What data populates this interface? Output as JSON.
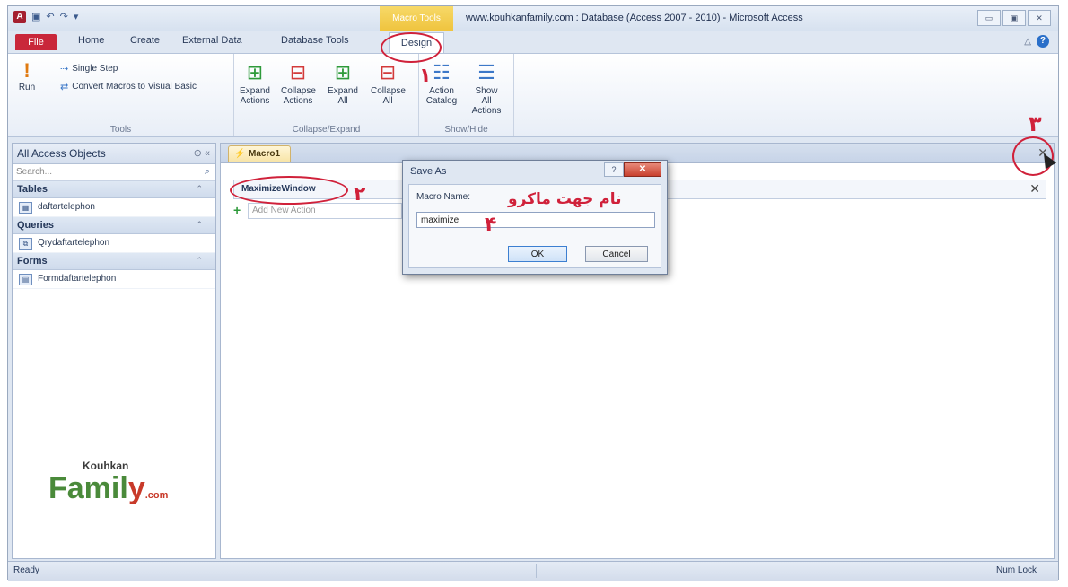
{
  "app": {
    "title": "www.kouhkanfamily.com : Database (Access 2007 - 2010)  -  Microsoft Access",
    "context_tab_header": "Macro Tools",
    "icons": [
      "access-logo-icon",
      "save-icon",
      "undo-icon",
      "redo-icon",
      "qat-dropdown-icon"
    ]
  },
  "window_controls": {
    "minimize": "▭",
    "maximize": "▣",
    "close": "✕"
  },
  "ribbon_tabs": [
    "File",
    "Home",
    "Create",
    "External Data",
    "Database Tools",
    "Design"
  ],
  "ribbon": {
    "tools": {
      "group_label": "Tools",
      "run_label": "Run",
      "single_step": "Single Step",
      "convert": "Convert Macros to Visual Basic"
    },
    "collapse_expand": {
      "group_label": "Collapse/Expand",
      "buttons": [
        {
          "line1": "Expand",
          "line2": "Actions",
          "icon": "expand-actions-icon"
        },
        {
          "line1": "Collapse",
          "line2": "Actions",
          "icon": "collapse-actions-icon"
        },
        {
          "line1": "Expand",
          "line2": "All",
          "icon": "expand-all-icon"
        },
        {
          "line1": "Collapse",
          "line2": "All",
          "icon": "collapse-all-icon"
        }
      ]
    },
    "show_hide": {
      "group_label": "Show/Hide",
      "buttons": [
        {
          "line1": "Action",
          "line2": "Catalog",
          "icon": "action-catalog-icon"
        },
        {
          "line1": "Show All",
          "line2": "Actions",
          "icon": "show-all-actions-icon"
        }
      ]
    }
  },
  "nav": {
    "title": "All Access Objects",
    "search_placeholder": "Search...",
    "categories": [
      {
        "label": "Tables",
        "items": [
          "daftartelephon"
        ]
      },
      {
        "label": "Queries",
        "items": [
          "Qrydaftartelephon"
        ]
      },
      {
        "label": "Forms",
        "items": [
          "Formdaftartelephon"
        ]
      }
    ]
  },
  "logo": {
    "line1": "Kouhkan",
    "family_prefix": "Famil",
    "family_y": "y",
    "suffix": ".com"
  },
  "document": {
    "tab_label": "Macro1",
    "action_name": "MaximizeWindow",
    "add_action_placeholder": "Add New Action"
  },
  "dialog": {
    "title": "Save As",
    "field_label": "Macro Name:",
    "field_value": "maximize",
    "ok": "OK",
    "cancel": "Cancel"
  },
  "annotations": {
    "num1": "١",
    "num2": "٢",
    "num3": "٣",
    "num4": "۴",
    "macro_name_note": "نام جهت ماکرو",
    "color": "#d0213a"
  },
  "status": {
    "left": "Ready",
    "right": "Num Lock"
  }
}
